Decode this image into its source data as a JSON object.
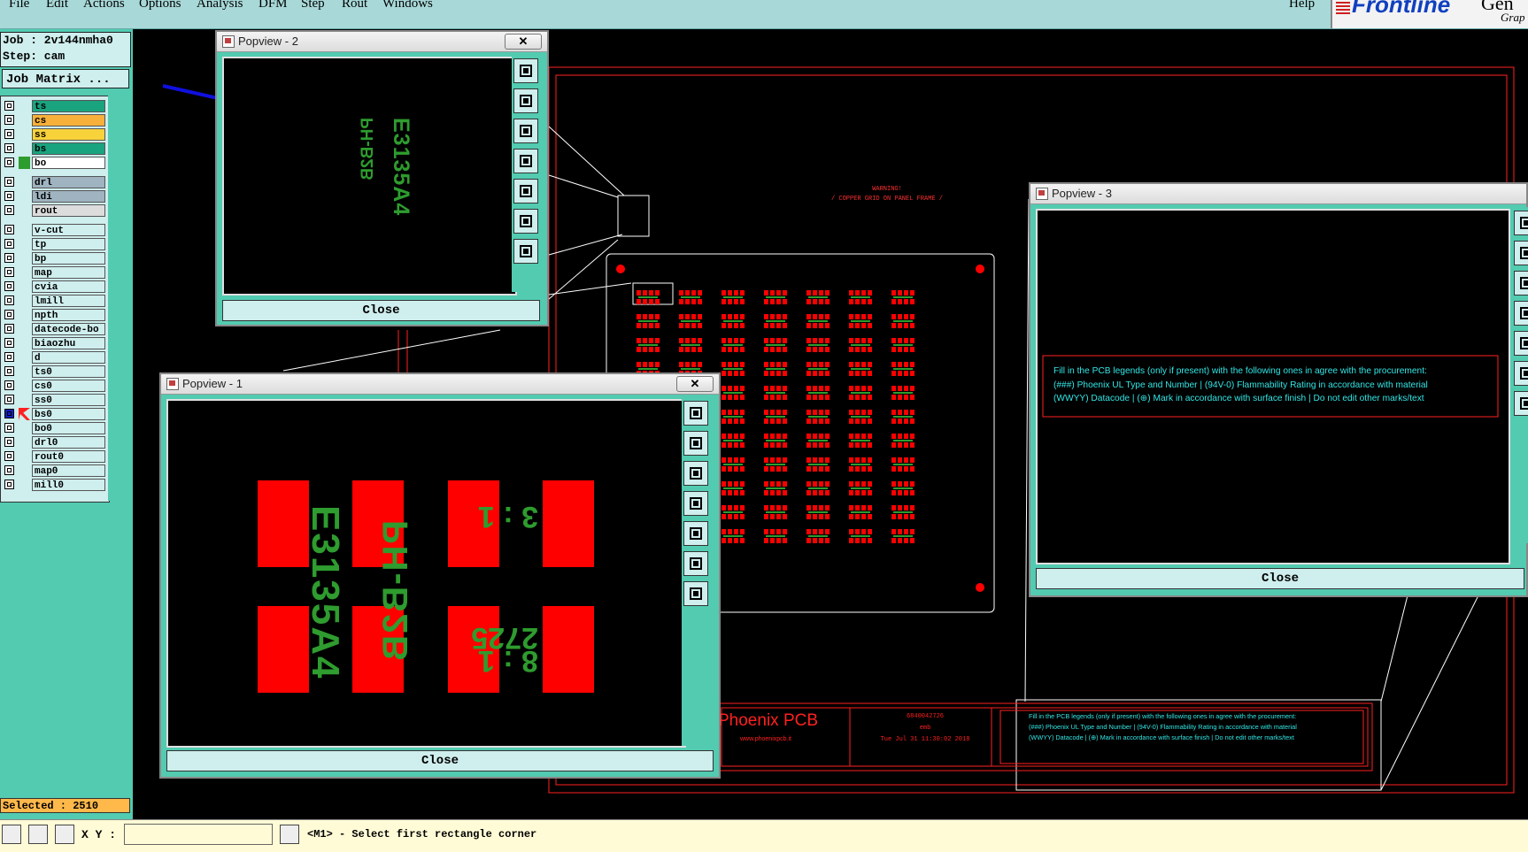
{
  "menubar": {
    "items": [
      "File",
      "Edit",
      "Actions",
      "Options",
      "Analysis",
      "DFM",
      "Step",
      "Rout",
      "Windows"
    ],
    "help": "Help",
    "brand": "Frontline",
    "brand_suffix": "Gen",
    "brand_sub": "Grap"
  },
  "job": {
    "job_line": "Job : 2v144nmha0",
    "step_line": "Step: cam",
    "matrix_button": "Job Matrix ..."
  },
  "layers": [
    {
      "name": "ts",
      "color": "#19a37e"
    },
    {
      "name": "cs",
      "color": "#f7b03a"
    },
    {
      "name": "ss",
      "color": "#f7d23a"
    },
    {
      "name": "bs",
      "color": "#19a37e"
    },
    {
      "name": "bo",
      "color": "#ffffff",
      "mark": "#2e9c2e"
    },
    {
      "name": "drl",
      "color": "#9fb3c0",
      "gap": true
    },
    {
      "name": "ldi",
      "color": "#9fb3c0"
    },
    {
      "name": "rout",
      "color": "#dcdcdc"
    },
    {
      "name": "v-cut",
      "color": "#cfeeee",
      "gap": true
    },
    {
      "name": "tp",
      "color": "#cfeeee"
    },
    {
      "name": "bp",
      "color": "#cfeeee"
    },
    {
      "name": "map",
      "color": "#cfeeee"
    },
    {
      "name": "cvia",
      "color": "#cfeeee"
    },
    {
      "name": "lmill",
      "color": "#cfeeee"
    },
    {
      "name": "npth",
      "color": "#cfeeee"
    },
    {
      "name": "datecode-bo",
      "color": "#cfeeee"
    },
    {
      "name": "biaozhu",
      "color": "#cfeeee"
    },
    {
      "name": "d",
      "color": "#cfeeee"
    },
    {
      "name": "ts0",
      "color": "#cfeeee"
    },
    {
      "name": "cs0",
      "color": "#cfeeee"
    },
    {
      "name": "ss0",
      "color": "#cfeeee"
    },
    {
      "name": "bs0",
      "color": "#cfeeee",
      "active": true
    },
    {
      "name": "bo0",
      "color": "#cfeeee"
    },
    {
      "name": "drl0",
      "color": "#cfeeee"
    },
    {
      "name": "rout0",
      "color": "#cfeeee"
    },
    {
      "name": "map0",
      "color": "#cfeeee"
    },
    {
      "name": "mill0",
      "color": "#cfeeee"
    }
  ],
  "status": {
    "selected": "Selected : 2510",
    "xy_label": "X Y :",
    "xy_value": "",
    "prompt": "<M1> - Select first rectangle corner"
  },
  "popviews": {
    "p1": {
      "title": "Popview - 1",
      "close": "Close"
    },
    "p2": {
      "title": "Popview - 2",
      "close": "Close"
    },
    "p3": {
      "title": "Popview - 3",
      "close": "Close"
    },
    "close_x": "✕"
  },
  "board": {
    "warning_line1": "WARNING!",
    "warning_line2": "/ COPPER GRID ON PANEL FRAME /",
    "logo_text": "Phoenix PCB",
    "website": "www.phoenixpcb.it",
    "info_line1": "6840042726",
    "info_line2": "emb",
    "info_line3": "Tue Jul 31 11:30:02 2018",
    "notice_line1": "Fill in the PCB legends (only if present) with the following ones in agree with the procurement:",
    "notice_line2": "(###) Phoenix UL Type and Number | (94V-0) Flammability Rating in accordance with material",
    "notice_line3": "(WWYY) Datacode | (⊕) Mark in accordance with surface finish | Do not edit other marks/text",
    "legend_text": {
      "partno": "E3135A4",
      "code": "PH-B2B",
      "row1": "3 : 1",
      "row2": "2725",
      "row3": "8 : 1"
    }
  },
  "icons": [
    "window-icon",
    "zoom-icon",
    "arrow-icon"
  ],
  "colors": {
    "teal": "#52cbb1",
    "copper_red": "#ff0000",
    "legend_green": "#2e9c2e",
    "arrow_blue": "#1010e0"
  }
}
